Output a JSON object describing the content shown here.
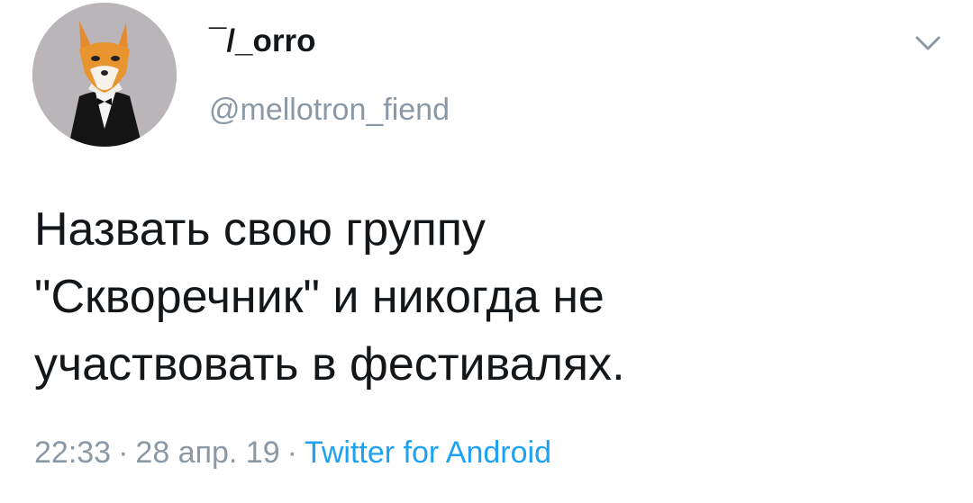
{
  "tweet": {
    "display_name": "¯/_orro",
    "handle": "@mellotron_fiend",
    "text": "Назвать свою группу\n\"Скворечник\" и никогда не\nучаствовать в фестивалях.",
    "time": "22:33",
    "date": "28 апр. 19",
    "source": "Twitter for Android",
    "separator": "·",
    "menu_icon": "chevron-down-icon",
    "avatar_icon": "fox-in-tuxedo-avatar"
  },
  "colors": {
    "text": "#14171a",
    "secondary": "#8b98a5",
    "link": "#1da1f2",
    "avatar_bg": "#b9b5b8"
  }
}
